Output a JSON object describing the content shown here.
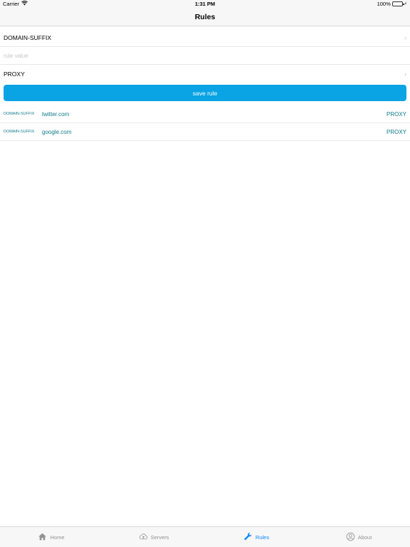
{
  "status_bar": {
    "carrier": "Carrier",
    "time": "1:31 PM",
    "battery_percent": "100%",
    "battery_level": 1.0
  },
  "nav": {
    "title": "Rules"
  },
  "form": {
    "type_value": "DOMAIN-SUFFIX",
    "value_placeholder": "rule value",
    "policy_value": "PROXY",
    "save_label": "save rule"
  },
  "rules": [
    {
      "type": "DOMAIN-SUFFIX",
      "value": "twitter.com",
      "policy": "PROXY"
    },
    {
      "type": "DOMAIN-SUFFIX",
      "value": "google.com",
      "policy": "PROXY"
    }
  ],
  "tabs": [
    {
      "label": "Home",
      "icon": "house-icon",
      "active": false
    },
    {
      "label": "Servers",
      "icon": "cloud-icon",
      "active": false
    },
    {
      "label": "Rules",
      "icon": "wrench-icon",
      "active": true
    },
    {
      "label": "About",
      "icon": "person-circle-icon",
      "active": false
    }
  ],
  "colors": {
    "accent": "#0aa3e4",
    "rule_text": "#0f7a8a",
    "tab_active": "#0a84ff",
    "tab_inactive": "#929292"
  }
}
